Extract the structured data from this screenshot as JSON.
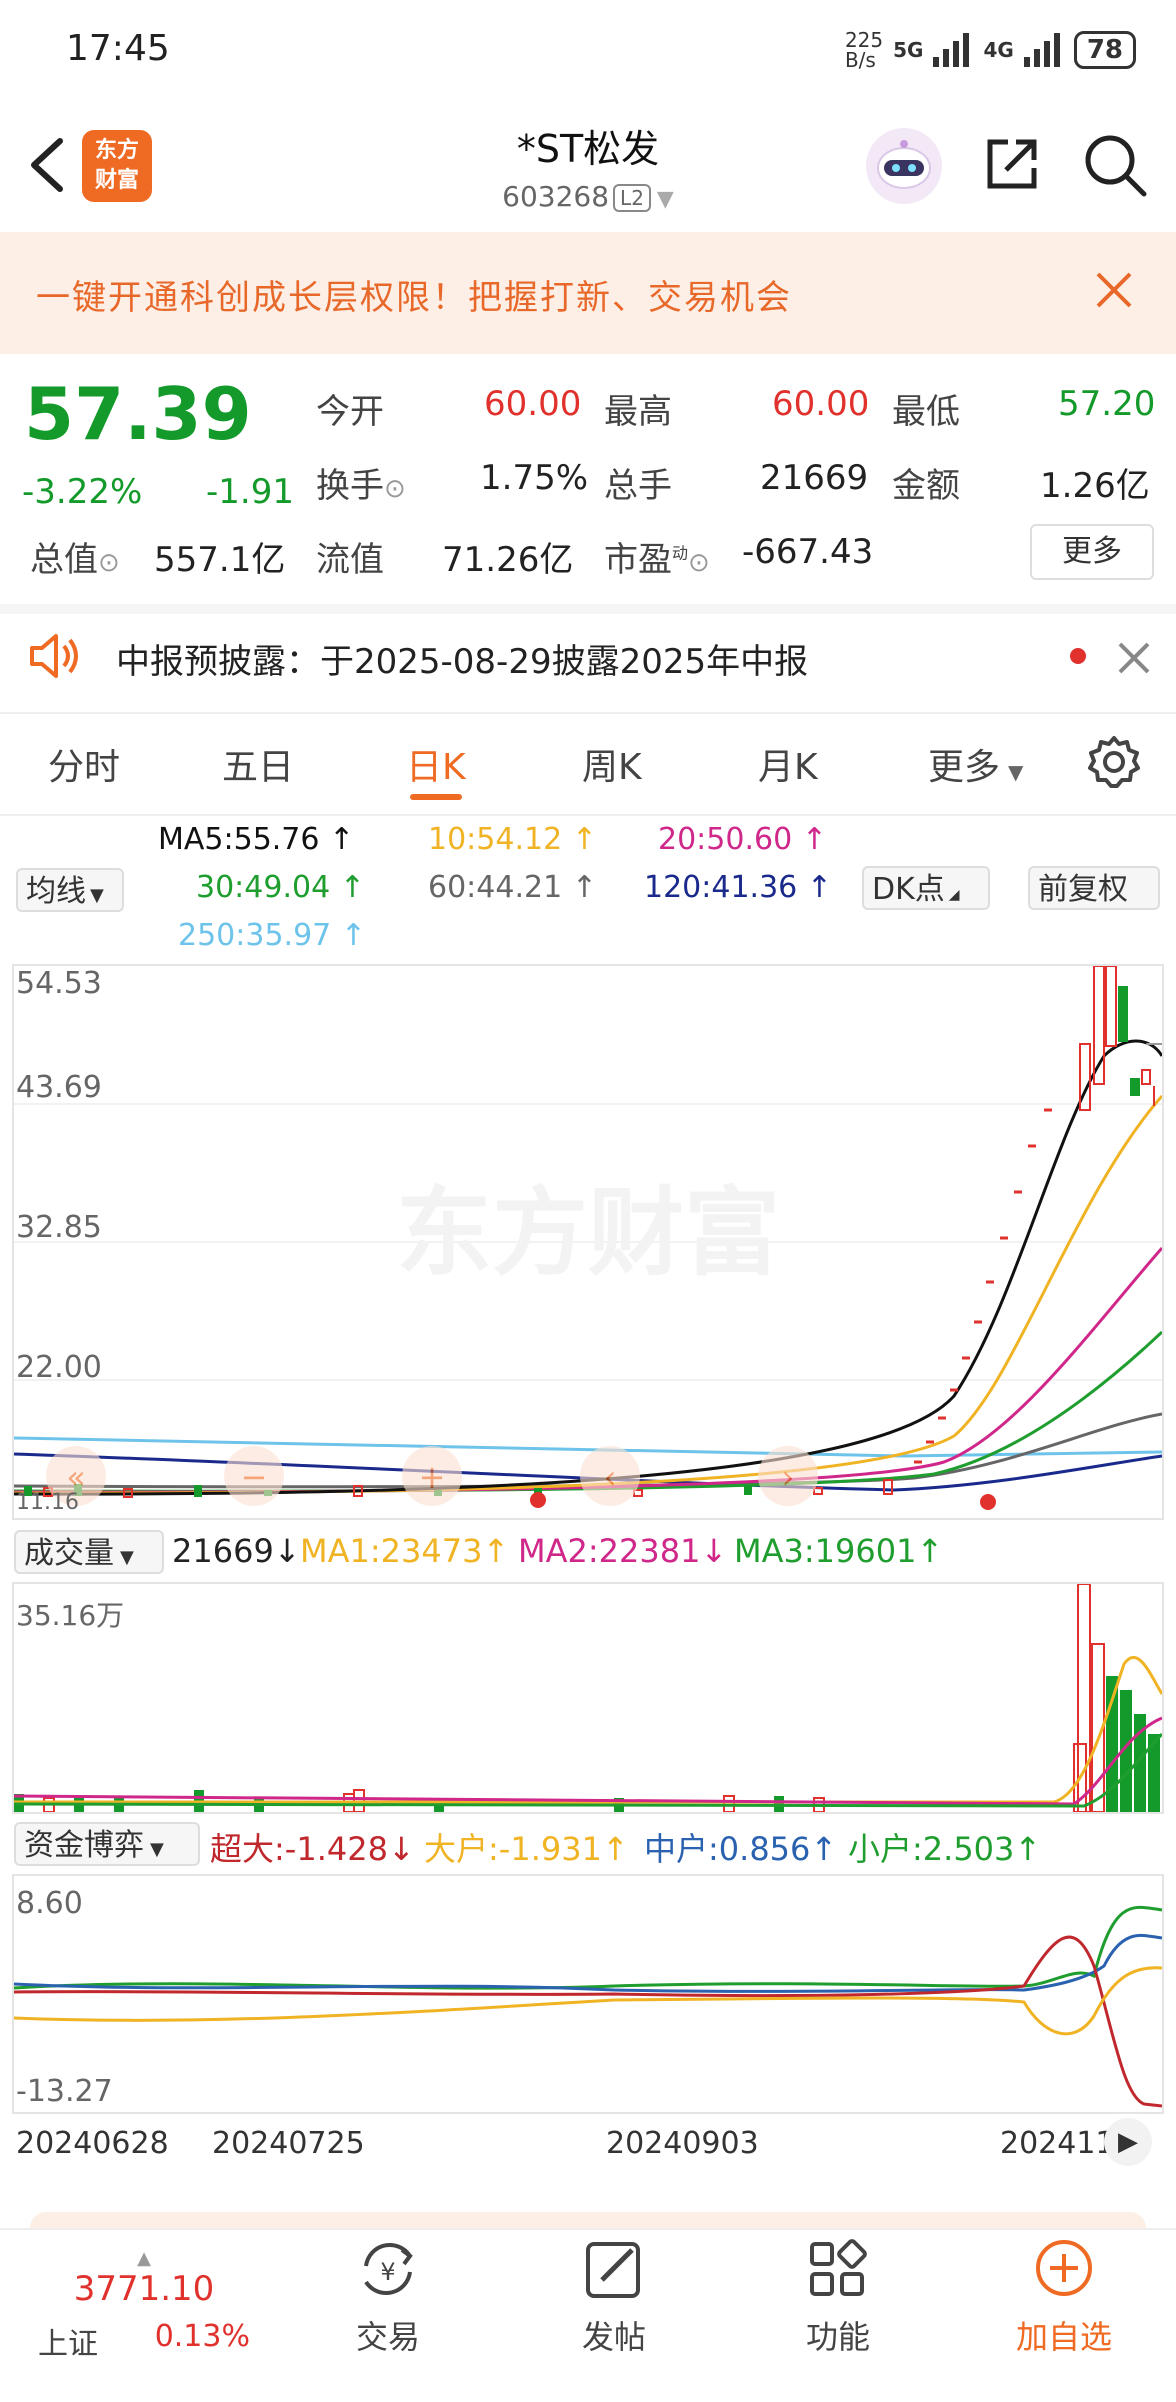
{
  "status": {
    "time": "17:45",
    "speed_top": "225",
    "speed_bottom": "B/s",
    "net1": "5G",
    "net2": "4G",
    "battery": "78"
  },
  "header": {
    "logo_line1": "东方",
    "logo_line2": "财富",
    "name": "*ST松发",
    "code": "603268",
    "level": "L2"
  },
  "banner": {
    "text": "一键开通科创成长层权限！把握打新、交易机会"
  },
  "quote": {
    "price": "57.39",
    "change_pct": "-3.22%",
    "change": "-1.91",
    "open_label": "今开",
    "open": "60.00",
    "high_label": "最高",
    "high": "60.00",
    "low_label": "最低",
    "low": "57.20",
    "turnover_label": "换手",
    "turnover": "1.75%",
    "volume_label": "总手",
    "volume": "21669",
    "amount_label": "金额",
    "amount": "1.26亿",
    "mktcap_label": "总值",
    "mktcap": "557.1亿",
    "float_label": "流值",
    "float": "71.26亿",
    "pe_label": "市盈",
    "pe_sup": "动",
    "pe": "-667.43",
    "more": "更多"
  },
  "notice": {
    "text": "中报预披露：于2025-08-29披露2025年中报"
  },
  "tabs": [
    "分时",
    "五日",
    "日K",
    "周K",
    "月K",
    "更多"
  ],
  "ma": {
    "selector": "均线",
    "ma5": "MA5:55.76 ↑",
    "ma10": "10:54.12 ↑",
    "ma20": "20:50.60 ↑",
    "ma30": "30:49.04 ↑",
    "ma60": "60:44.21 ↑",
    "ma120": "120:41.36 ↑",
    "ma250": "250:35.97 ↑",
    "dk": "DK点",
    "adjust": "前复权"
  },
  "colors": {
    "ma5": "#111111",
    "ma10": "#f0b323",
    "ma20": "#d0278a",
    "ma30": "#1f9e2f",
    "ma60": "#666666",
    "ma120": "#1a2a8c",
    "ma250": "#6ec3ea",
    "up": "#e0312d",
    "down": "#139a2a",
    "accent": "#ef6a22"
  },
  "kline": {
    "y_ticks": [
      "54.53",
      "43.69",
      "32.85",
      "22.00",
      "11.16"
    ],
    "watermark": "东方财富"
  },
  "volume": {
    "selector": "成交量",
    "value": "21669↓",
    "ma1": "MA1:23473↑",
    "ma2": "MA2:22381↓",
    "ma3": "MA3:19601↑",
    "max_label": "35.16万"
  },
  "capital": {
    "selector": "资金博弈",
    "super": "超大:-1.428↓",
    "big": "大户:-1.931↑",
    "mid": "中户:0.856↑",
    "small": "小户:2.503↑",
    "y_top": "8.60",
    "y_bottom": "-13.27"
  },
  "dates": [
    "20240628",
    "20240725",
    "20240903",
    "202411"
  ],
  "nav": {
    "index_value": "3771.10",
    "index_name": "上证",
    "index_pct": "0.13%",
    "trade": "交易",
    "post": "发帖",
    "func": "功能",
    "add": "加自选"
  }
}
